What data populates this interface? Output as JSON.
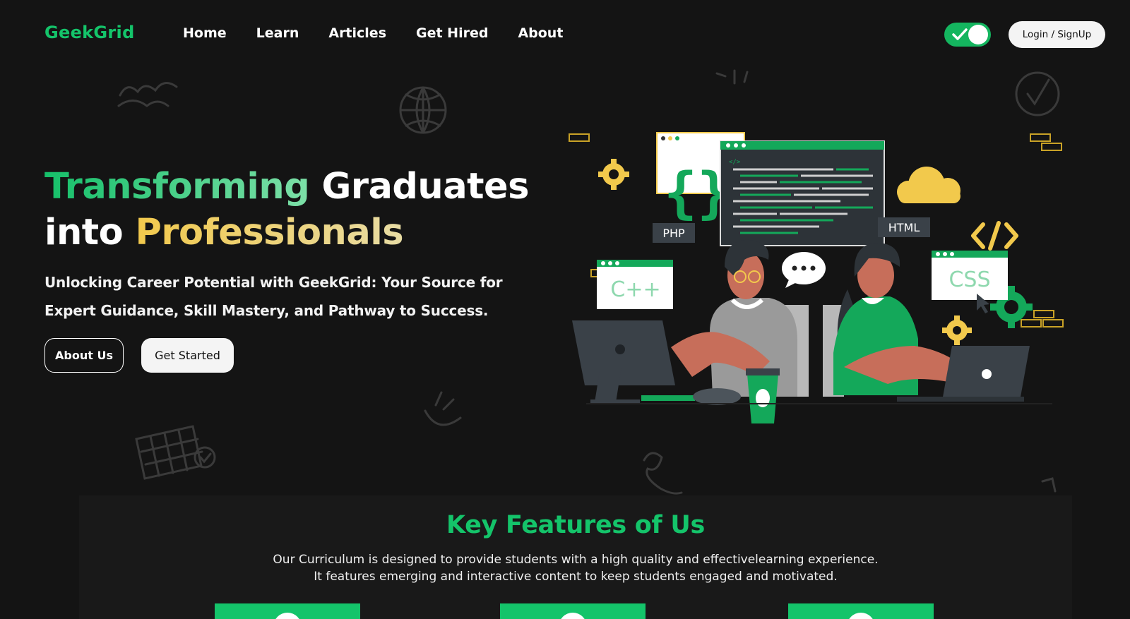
{
  "brand": {
    "name": "GeekGrid",
    "accent": "#14c46a"
  },
  "nav": {
    "links": [
      "Home",
      "Learn",
      "Articles",
      "Get Hired",
      "About"
    ],
    "theme_toggle_on": true,
    "login_label": "Login / SignUp"
  },
  "hero": {
    "title_part1": "Transforming",
    "title_part2": "Graduates",
    "title_part3": "into",
    "title_part4": "Professionals",
    "subtitle": "Unlocking Career Potential with GeekGrid: Your Source for Expert Guidance, Skill Mastery, and Pathway to Success.",
    "about_button": "About Us",
    "start_button": "Get Started",
    "illustration_labels": {
      "php": "PHP",
      "html": "HTML",
      "cpp": "C++",
      "css": "CSS"
    }
  },
  "features": {
    "title": "Key Features of Us",
    "desc_line1": "Our Curriculum is designed to provide students with a high quality and effectivelearning experience.",
    "desc_line2": "It features emerging and interactive content to keep students engaged and motivated.",
    "cards": 3
  },
  "colors": {
    "background": "#141414",
    "green": "#14c46a",
    "gold": "#f2c94c",
    "panel": "#191919"
  }
}
